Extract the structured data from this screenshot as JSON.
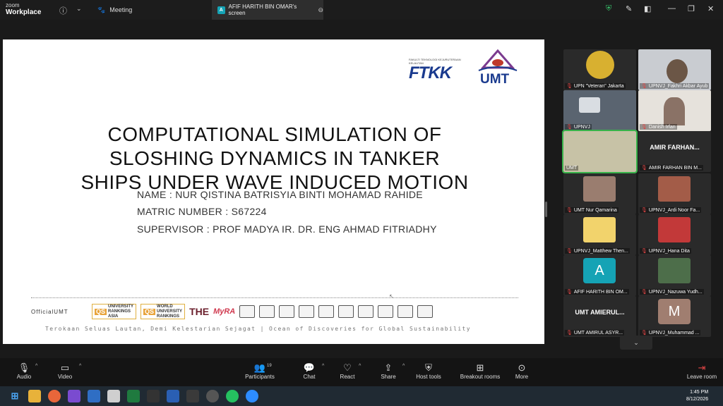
{
  "app": {
    "brand_small": "zoom",
    "brand": "Workplace"
  },
  "tabs": {
    "meeting": "Meeting",
    "share": "AFIF HARITH BIN OMAR's screen",
    "share_badge": "A"
  },
  "slide": {
    "ftkk_small": "FAKULTI TEKNOLOGI KEJURUTERAAN KELAUTAN",
    "ftkk": "FTKK",
    "umt": "UMT",
    "title_lines": [
      "COMPUTATIONAL  SIMULATION  OF",
      "SLOSHING  DYNAMICS  IN  TANKER",
      "SHIPS UNDER  WAVE  INDUCED  MOTION"
    ],
    "name": "NAME : NUR QISTINA BATRISYIA BINTI MOHAMAD RAHIDE",
    "matric": "MATRIC NUMBER : S67224",
    "supervisor": "SUPERVISOR : PROF MADYA IR. DR. ENG AHMAD FITRIADHY",
    "footer": {
      "official": "OfficialUMT",
      "qs_asia": [
        "UNIVERSITY",
        "RANKINGS",
        "ASIA"
      ],
      "qs_world": [
        "WORLD",
        "UNIVERSITY",
        "RANKINGS"
      ],
      "the": "THE",
      "myra": "MyRA"
    },
    "tagline": "Terokaan Seluas Lautan, Demi Kelestarian Sejagat | Ocean of Discoveries for Global Sustainability"
  },
  "participants": [
    {
      "name": "UPN \"Veteran\" Jakarta",
      "kind": "logo",
      "color": "#d8b030"
    },
    {
      "name": "UPNVJ_Fakhri Akbar Ayub",
      "kind": "video",
      "color": "#c9ccd1"
    },
    {
      "name": "UPNVJ",
      "kind": "video",
      "color": "#5a6470"
    },
    {
      "name": "Danish Irfan",
      "kind": "video",
      "color": "#8a7266"
    },
    {
      "name": "UMT",
      "kind": "video",
      "color": "#c7c2a6",
      "active": true
    },
    {
      "name": "AMIR FARHAN BIN M...",
      "kind": "text",
      "title": "AMIR FARHAN..."
    },
    {
      "name": "UMT Nur Qamarina",
      "kind": "image",
      "color": "#9a7d6f"
    },
    {
      "name": "UPNVJ_Ardi Noor Fa...",
      "kind": "image",
      "color": "#a35c48"
    },
    {
      "name": "UPNVJ_Matthew Then...",
      "kind": "image",
      "color": "#f2d36c"
    },
    {
      "name": "UPNVJ_Hana Dita",
      "kind": "image",
      "color": "#c23939"
    },
    {
      "name": "AFIF HARITH BIN OM...",
      "kind": "letter",
      "letter": "A",
      "color": "#15a3b5"
    },
    {
      "name": "UPNVJ_Nazuwa Yudh...",
      "kind": "image",
      "color": "#4d6e4a"
    },
    {
      "name": "UMT AMIRUL ASYR...",
      "kind": "text",
      "title": "UMT AMIERUL..."
    },
    {
      "name": "UPNVJ_Muhammad ...",
      "kind": "letter",
      "letter": "M",
      "color": "#a07e70"
    }
  ],
  "controls": {
    "audio": "Audio",
    "video": "Video",
    "participants": "Participants",
    "participants_count": "19",
    "chat": "Chat",
    "react": "React",
    "share": "Share",
    "host_tools": "Host tools",
    "breakout": "Breakout rooms",
    "more": "More",
    "leave": "Leave room"
  },
  "taskbar": {
    "time": "1:45 PM",
    "date": "8/12/2026"
  }
}
